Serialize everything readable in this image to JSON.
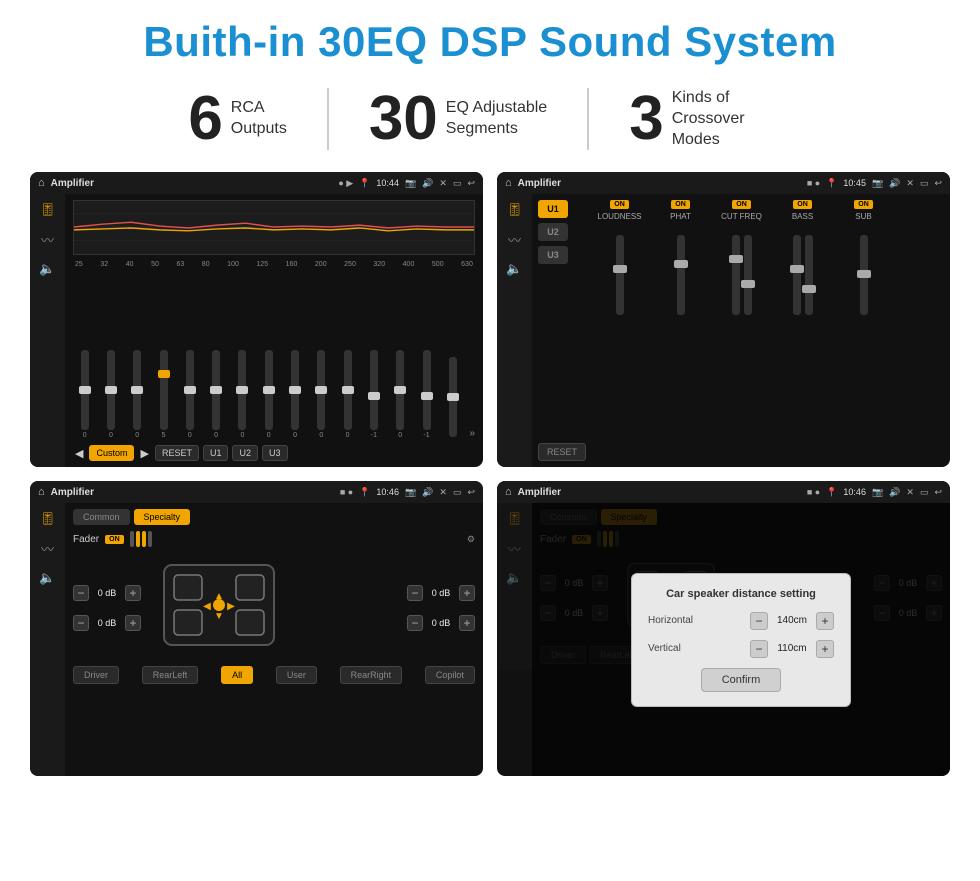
{
  "title": "Buith-in 30EQ DSP Sound System",
  "stats": [
    {
      "number": "6",
      "label_line1": "RCA",
      "label_line2": "Outputs"
    },
    {
      "number": "30",
      "label_line1": "EQ Adjustable",
      "label_line2": "Segments"
    },
    {
      "number": "3",
      "label_line1": "Kinds of",
      "label_line2": "Crossover Modes"
    }
  ],
  "screens": [
    {
      "id": "screen1",
      "top_bar": {
        "title": "Amplifier",
        "time": "10:44"
      },
      "eq_freqs": [
        "25",
        "32",
        "40",
        "50",
        "63",
        "80",
        "100",
        "125",
        "160",
        "200",
        "250",
        "320",
        "400",
        "500",
        "630"
      ],
      "eq_values": [
        "0",
        "0",
        "0",
        "5",
        "0",
        "0",
        "0",
        "0",
        "0",
        "0",
        "0",
        "-1",
        "0",
        "-1",
        ""
      ],
      "bottom_btns": [
        "Custom",
        "RESET",
        "U1",
        "U2",
        "U3"
      ]
    },
    {
      "id": "screen2",
      "top_bar": {
        "title": "Amplifier",
        "time": "10:45"
      },
      "presets": [
        "U1",
        "U2",
        "U3"
      ],
      "channels": [
        "LOUDNESS",
        "PHAT",
        "CUT FREQ",
        "BASS",
        "SUB"
      ],
      "reset_label": "RESET"
    },
    {
      "id": "screen3",
      "top_bar": {
        "title": "Amplifier",
        "time": "10:46"
      },
      "tabs": [
        "Common",
        "Specialty"
      ],
      "fader_label": "Fader",
      "fader_on": "ON",
      "vol_rows": [
        {
          "label": "— 0 dB +",
          "side": "left"
        },
        {
          "label": "— 0 dB +",
          "side": "left"
        },
        {
          "label": "— 0 dB +",
          "side": "right"
        },
        {
          "label": "— 0 dB +",
          "side": "right"
        }
      ],
      "bottom_btns": [
        "Driver",
        "RearLeft",
        "All",
        "User",
        "RearRight",
        "Copilot"
      ]
    },
    {
      "id": "screen4",
      "top_bar": {
        "title": "Amplifier",
        "time": "10:46"
      },
      "tabs": [
        "Common",
        "Specialty"
      ],
      "dialog": {
        "title": "Car speaker distance setting",
        "horizontal_label": "Horizontal",
        "horizontal_value": "140cm",
        "vertical_label": "Vertical",
        "vertical_value": "110cm",
        "confirm_label": "Confirm"
      },
      "vol_rows": [
        {
          "value": "0 dB"
        },
        {
          "value": "0 dB"
        }
      ],
      "bottom_btns": [
        "Driver",
        "RearLeft",
        "All",
        "User",
        "RearRight",
        "Copilot"
      ]
    }
  ]
}
